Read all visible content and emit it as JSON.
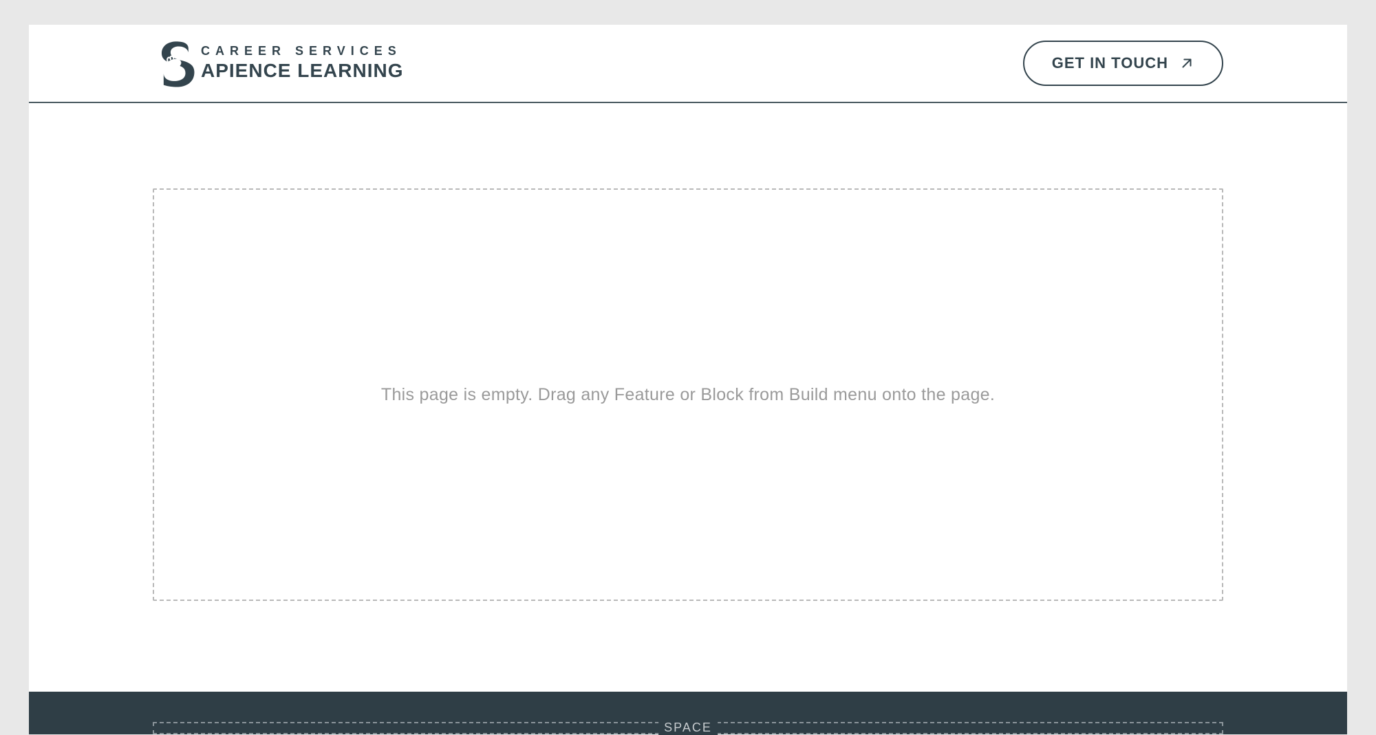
{
  "header": {
    "logo": {
      "line1": "CAREER SERVICES",
      "line2": "APIENCE LEARNING"
    },
    "cta_label": "GET IN TOUCH"
  },
  "main": {
    "dropzone_text": "This page is empty. Drag any Feature or Block from Build menu onto the page."
  },
  "footer": {
    "space_label": "SPACE"
  },
  "colors": {
    "brand_dark": "#33444d",
    "page_bg": "#ffffff",
    "outer_bg": "#e8e8e8",
    "footer_bg": "#2f3e46",
    "muted_text": "#9a9a9a"
  }
}
